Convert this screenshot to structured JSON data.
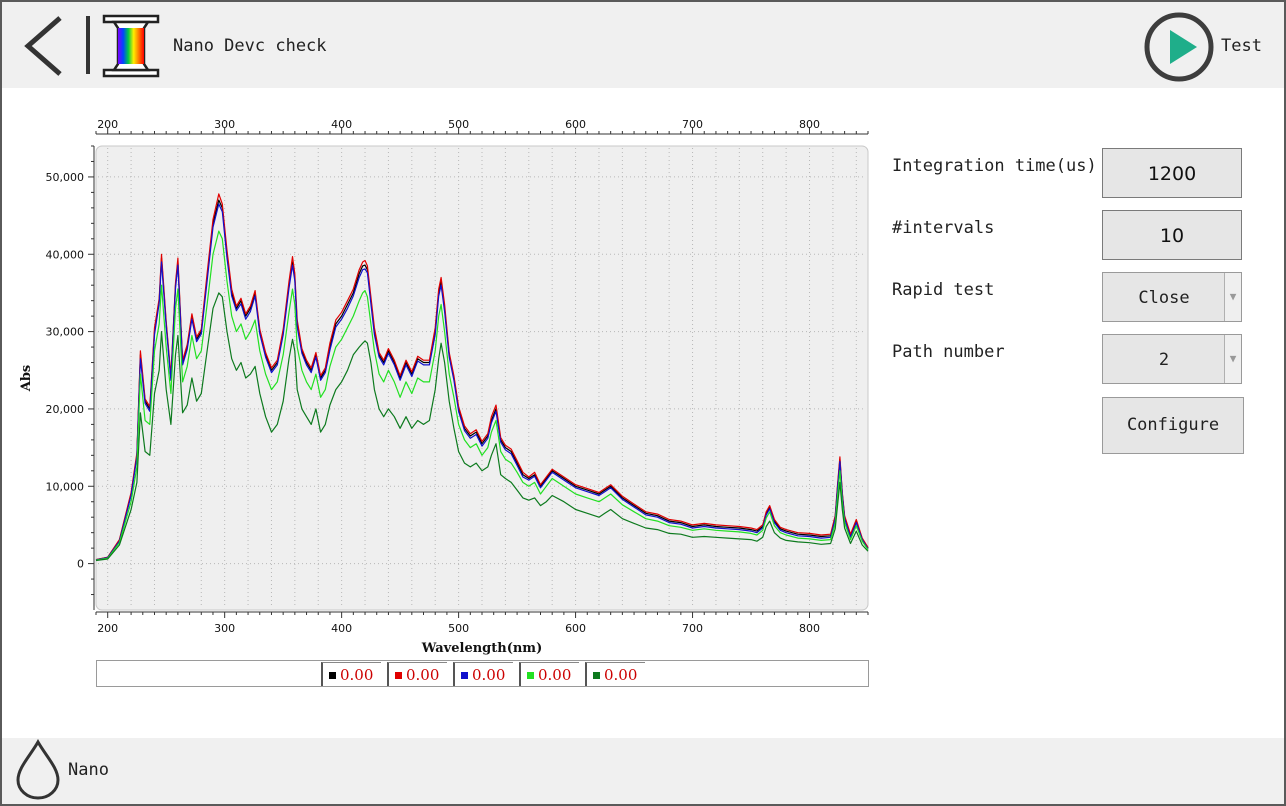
{
  "header": {
    "title": "Nano Devc check",
    "run_label": "Test"
  },
  "footer": {
    "label": "Nano"
  },
  "icons": {
    "back": "chevron-left-icon",
    "device": "spectrum-spool-icon",
    "run": "play-icon",
    "drop": "drop-icon"
  },
  "colors": {
    "run_accent": "#1fae8a",
    "ring": "#3d3d3d",
    "plot_bg": "#efefef"
  },
  "form": {
    "integration_label": "Integration time(us)",
    "integration_value": "1200",
    "intervals_label": "#intervals",
    "intervals_value": "10",
    "rapid_label": "Rapid test",
    "rapid_value": "Close",
    "path_label": "Path number",
    "path_value": "2",
    "configure_label": "Configure"
  },
  "chart_data": {
    "type": "line",
    "xlabel": "Wavelength(nm)",
    "ylabel": "Abs",
    "xlim": [
      190,
      850
    ],
    "ylim": [
      -6000,
      54000
    ],
    "x_ticks": [
      200,
      300,
      400,
      500,
      600,
      700,
      800
    ],
    "y_ticks": [
      0,
      10000,
      20000,
      30000,
      40000,
      50000
    ],
    "y_tick_labels": [
      "0",
      "10,000",
      "20,000",
      "30,000",
      "40,000",
      "50,000"
    ],
    "grid": true,
    "legend_position": "bottom",
    "legend": [
      {
        "color": "#000000",
        "value": "0.00"
      },
      {
        "color": "#e00000",
        "value": "0.00"
      },
      {
        "color": "#1010cc",
        "value": "0.00"
      },
      {
        "color": "#22e022",
        "value": "0.00"
      },
      {
        "color": "#0d7a1e",
        "value": "0.00"
      }
    ],
    "x": [
      190,
      200,
      210,
      220,
      225,
      228,
      232,
      236,
      240,
      244,
      246,
      250,
      254,
      258,
      260,
      264,
      268,
      272,
      276,
      280,
      285,
      290,
      295,
      298,
      302,
      306,
      310,
      314,
      318,
      322,
      326,
      330,
      335,
      340,
      345,
      350,
      355,
      358,
      360,
      362,
      366,
      370,
      374,
      378,
      382,
      386,
      390,
      395,
      400,
      405,
      410,
      415,
      418,
      420,
      422,
      425,
      428,
      432,
      436,
      440,
      445,
      450,
      455,
      460,
      465,
      470,
      475,
      480,
      483,
      485,
      488,
      492,
      496,
      500,
      505,
      510,
      515,
      520,
      525,
      528,
      532,
      536,
      540,
      545,
      550,
      555,
      560,
      565,
      570,
      575,
      580,
      590,
      600,
      610,
      620,
      625,
      630,
      640,
      650,
      660,
      670,
      680,
      690,
      700,
      710,
      720,
      730,
      740,
      750,
      755,
      760,
      763,
      766,
      770,
      775,
      780,
      790,
      800,
      810,
      818,
      822,
      824,
      826,
      828,
      830,
      835,
      840,
      845,
      850
    ],
    "series": [
      {
        "color": "#000000",
        "values": [
          500,
          800,
          3000,
          9000,
          14000,
          27000,
          21000,
          20000,
          30000,
          34000,
          39500,
          31000,
          24000,
          36000,
          39000,
          26000,
          28000,
          32000,
          29000,
          30000,
          37000,
          44000,
          47000,
          46000,
          40000,
          35000,
          33000,
          34000,
          32000,
          33000,
          35000,
          30000,
          27000,
          25000,
          26000,
          30000,
          36000,
          39000,
          37000,
          31000,
          27500,
          26000,
          25000,
          27000,
          24000,
          25000,
          28000,
          31000,
          32000,
          33500,
          35000,
          37500,
          38500,
          38600,
          38000,
          34000,
          30000,
          27000,
          26000,
          27500,
          26000,
          24000,
          26000,
          24500,
          26500,
          26000,
          26000,
          30000,
          35000,
          36500,
          33000,
          27000,
          24000,
          20000,
          17500,
          16500,
          17000,
          15500,
          16500,
          18500,
          20000,
          16000,
          15000,
          14500,
          13000,
          11500,
          11000,
          11500,
          10000,
          11000,
          12000,
          11000,
          10000,
          9500,
          9000,
          9500,
          10000,
          8500,
          7500,
          6500,
          6200,
          5500,
          5300,
          4800,
          5000,
          4800,
          4700,
          4600,
          4400,
          4200,
          4800,
          6500,
          7300,
          5500,
          4500,
          4200,
          3800,
          3700,
          3500,
          3600,
          6000,
          10000,
          13500,
          9000,
          6000,
          3600,
          5500,
          3200,
          2000
        ]
      },
      {
        "color": "#e00000",
        "values": [
          520,
          830,
          3100,
          9200,
          14300,
          27500,
          21300,
          20300,
          30500,
          34300,
          40000,
          31300,
          24300,
          36300,
          39500,
          26300,
          28300,
          32300,
          29300,
          30300,
          37500,
          44500,
          47800,
          46500,
          40500,
          35500,
          33300,
          34300,
          32300,
          33300,
          35300,
          30300,
          27300,
          25300,
          26300,
          30300,
          36500,
          39700,
          37500,
          31500,
          27800,
          26300,
          25300,
          27300,
          24300,
          25300,
          28500,
          31500,
          32500,
          34000,
          35500,
          38000,
          39000,
          39200,
          38500,
          34500,
          30500,
          27300,
          26300,
          27800,
          26300,
          24300,
          26300,
          24800,
          26800,
          26300,
          26300,
          30500,
          35500,
          37000,
          33500,
          27300,
          24300,
          20300,
          17800,
          16800,
          17300,
          15800,
          16800,
          19000,
          20500,
          16300,
          15300,
          14800,
          13300,
          11800,
          11200,
          11800,
          10200,
          11200,
          12200,
          11200,
          10200,
          9700,
          9200,
          9700,
          10200,
          8700,
          7700,
          6700,
          6400,
          5700,
          5500,
          5000,
          5200,
          5000,
          4900,
          4800,
          4600,
          4400,
          5000,
          6700,
          7500,
          5700,
          4700,
          4400,
          4000,
          3900,
          3700,
          3800,
          6200,
          10300,
          13800,
          9200,
          6200,
          3800,
          5700,
          3300,
          2100
        ]
      },
      {
        "color": "#1010cc",
        "values": [
          480,
          780,
          2900,
          8800,
          13800,
          26500,
          20700,
          19700,
          29600,
          33700,
          39000,
          30700,
          23700,
          35600,
          38600,
          25700,
          27700,
          31600,
          28700,
          29700,
          36500,
          43500,
          46500,
          45500,
          39500,
          34600,
          32700,
          33600,
          31600,
          32600,
          34600,
          29700,
          26700,
          24700,
          25700,
          29600,
          35600,
          38600,
          36600,
          30600,
          27200,
          25700,
          24700,
          26700,
          23700,
          24700,
          27600,
          30600,
          31600,
          33000,
          34600,
          37000,
          38000,
          38100,
          37600,
          33600,
          29600,
          26700,
          25700,
          27200,
          25700,
          23700,
          25700,
          24200,
          26200,
          25700,
          25700,
          29600,
          34600,
          36000,
          32600,
          26700,
          23700,
          19700,
          17200,
          16200,
          16700,
          15200,
          16200,
          18200,
          19700,
          15700,
          14700,
          14200,
          12700,
          11200,
          10800,
          11300,
          9800,
          10800,
          11800,
          10800,
          9800,
          9300,
          8800,
          9300,
          9800,
          8300,
          7300,
          6300,
          6000,
          5300,
          5100,
          4600,
          4800,
          4600,
          4500,
          4400,
          4200,
          4000,
          4600,
          6300,
          7100,
          5300,
          4300,
          4000,
          3600,
          3500,
          3300,
          3400,
          5800,
          9800,
          13200,
          8800,
          5800,
          3400,
          5300,
          3100,
          1900
        ]
      },
      {
        "color": "#22e022",
        "values": [
          450,
          700,
          2700,
          8000,
          12500,
          24500,
          18500,
          18000,
          27500,
          31000,
          36000,
          28000,
          22000,
          33000,
          35500,
          23500,
          25500,
          29500,
          26500,
          27500,
          33500,
          40000,
          43000,
          42000,
          36500,
          32000,
          30000,
          31000,
          29000,
          30000,
          31500,
          27500,
          24500,
          22500,
          23500,
          27000,
          32500,
          35500,
          33500,
          28000,
          25000,
          23500,
          22500,
          24500,
          21500,
          22500,
          25500,
          28000,
          29000,
          30500,
          32000,
          34000,
          35000,
          35300,
          34500,
          31000,
          27500,
          24500,
          23500,
          25000,
          23500,
          21500,
          23500,
          22000,
          24000,
          23500,
          23500,
          27500,
          32000,
          33500,
          30000,
          24500,
          21500,
          18000,
          16000,
          15000,
          15500,
          14000,
          15000,
          17000,
          18500,
          14500,
          13500,
          13000,
          11800,
          10500,
          10000,
          10500,
          9000,
          10000,
          11000,
          10000,
          9000,
          8500,
          8000,
          8500,
          9000,
          7600,
          6700,
          5800,
          5500,
          4900,
          4700,
          4300,
          4500,
          4300,
          4200,
          4100,
          3900,
          3700,
          4300,
          5900,
          6700,
          4900,
          4000,
          3700,
          3300,
          3200,
          3000,
          3100,
          5200,
          8800,
          12000,
          8000,
          5300,
          3100,
          4900,
          2900,
          1800
        ]
      },
      {
        "color": "#0d7a1e",
        "values": [
          400,
          600,
          2400,
          7000,
          10500,
          19500,
          14500,
          14000,
          22000,
          25000,
          30000,
          22500,
          18000,
          27000,
          29500,
          19500,
          20500,
          24000,
          21000,
          22000,
          27500,
          33000,
          35000,
          34500,
          30000,
          26500,
          25000,
          26000,
          24000,
          24500,
          25500,
          22000,
          19000,
          17000,
          18000,
          21000,
          26500,
          29000,
          27500,
          22500,
          20000,
          19000,
          18000,
          20000,
          17000,
          18000,
          20500,
          22500,
          23500,
          25000,
          27000,
          28000,
          28500,
          28800,
          28500,
          26000,
          22500,
          20000,
          19000,
          20000,
          19000,
          17500,
          19000,
          17500,
          18500,
          18000,
          18500,
          22500,
          26500,
          28500,
          26000,
          21000,
          17500,
          14500,
          13000,
          12500,
          13000,
          12000,
          12500,
          14000,
          15500,
          11500,
          11000,
          10500,
          9500,
          8500,
          8200,
          8500,
          7500,
          8000,
          8800,
          8000,
          7000,
          6500,
          6000,
          6500,
          7000,
          5800,
          5200,
          4600,
          4400,
          3900,
          3800,
          3400,
          3500,
          3400,
          3300,
          3200,
          3100,
          2900,
          3400,
          4800,
          5500,
          4000,
          3300,
          3000,
          2800,
          2700,
          2500,
          2600,
          4500,
          7600,
          10500,
          7000,
          4600,
          2600,
          4200,
          2400,
          1600
        ]
      }
    ]
  }
}
